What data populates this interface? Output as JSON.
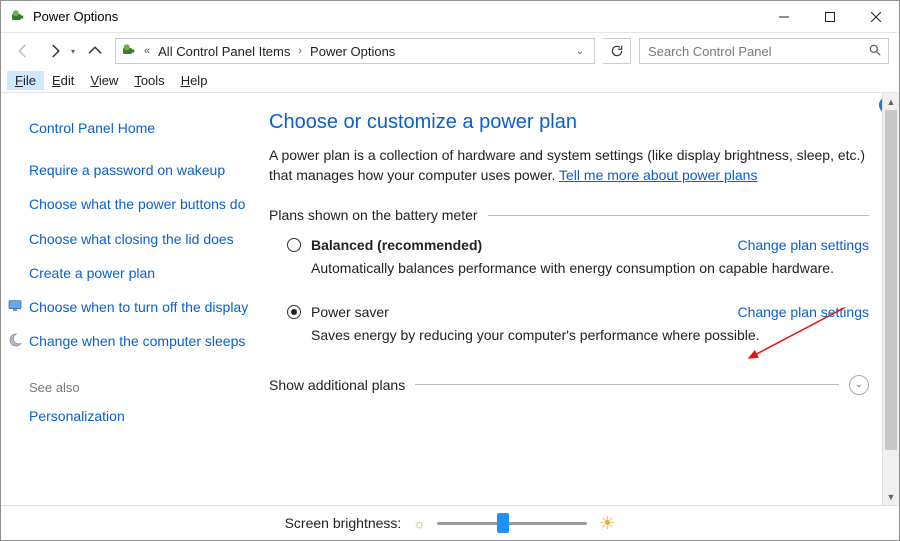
{
  "window": {
    "title": "Power Options"
  },
  "breadcrumb": {
    "prefix": "«",
    "item1": "All Control Panel Items",
    "item2": "Power Options"
  },
  "search": {
    "placeholder": "Search Control Panel"
  },
  "menubar": {
    "file": "File",
    "edit": "Edit",
    "view": "View",
    "tools": "Tools",
    "help": "Help"
  },
  "sidebar": {
    "home": "Control Panel Home",
    "links": [
      "Require a password on wakeup",
      "Choose what the power buttons do",
      "Choose what closing the lid does",
      "Create a power plan",
      "Choose when to turn off the display",
      "Change when the computer sleeps"
    ],
    "see_also_label": "See also",
    "see_also_links": [
      "Personalization"
    ]
  },
  "main": {
    "heading": "Choose or customize a power plan",
    "description_pre": "A power plan is a collection of hardware and system settings (like display brightness, sleep, etc.) that manages how your computer uses power. ",
    "description_link": "Tell me more about power plans",
    "plans_label": "Plans shown on the battery meter",
    "plans": [
      {
        "name": "Balanced (recommended)",
        "selected": false,
        "bold": true,
        "desc": "Automatically balances performance with energy consumption on capable hardware.",
        "link": "Change plan settings"
      },
      {
        "name": "Power saver",
        "selected": true,
        "bold": false,
        "desc": "Saves energy by reducing your computer's performance where possible.",
        "link": "Change plan settings"
      }
    ],
    "additional_label": "Show additional plans"
  },
  "bottom": {
    "brightness_label": "Screen brightness:"
  }
}
